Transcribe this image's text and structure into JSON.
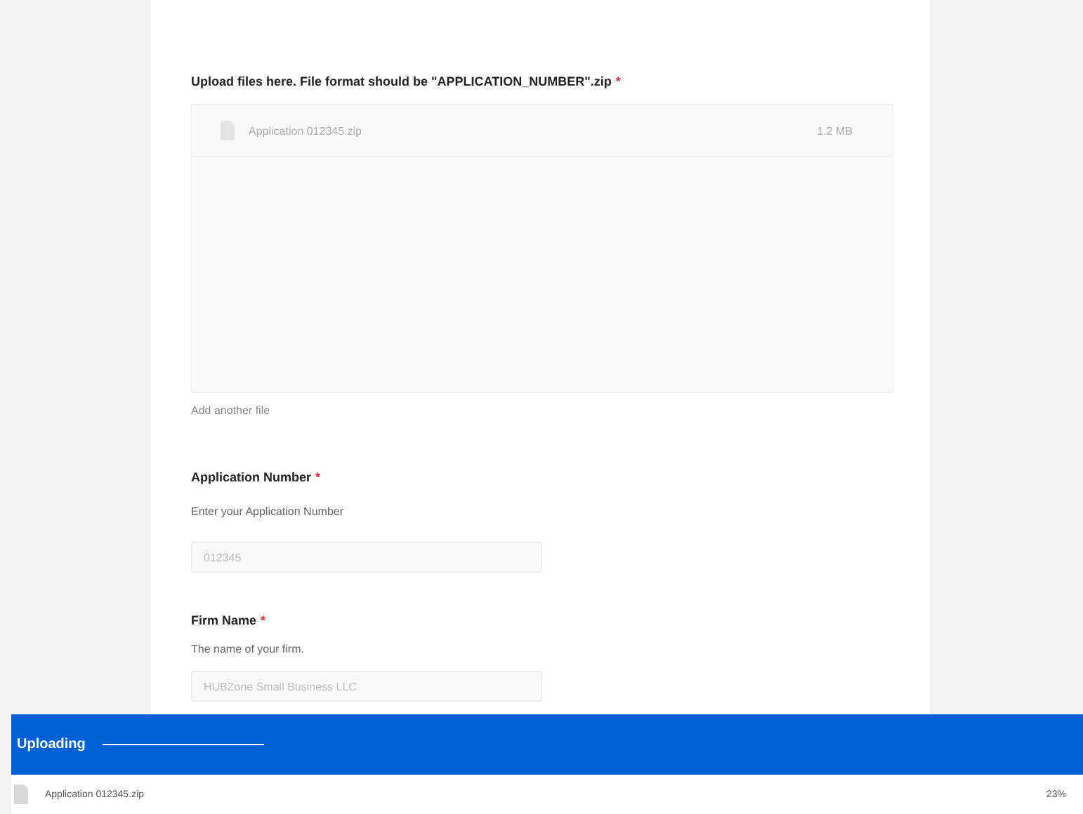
{
  "upload": {
    "label": "Upload files here. File format should be \"APPLICATION_NUMBER\".zip",
    "required_mark": "*",
    "files": [
      {
        "name": "Application 012345.zip",
        "size": "1.2 MB"
      }
    ],
    "add_link": "Add another file"
  },
  "fields": [
    {
      "label": "Application Number",
      "required_mark": "*",
      "description": "Enter your Application Number",
      "value": "012345"
    },
    {
      "label": "Firm Name",
      "required_mark": "*",
      "description": "The name of your firm.",
      "value": "HUBZone Small Business LLC"
    }
  ],
  "upload_panel": {
    "title": "Uploading",
    "items": [
      {
        "name": "Application 012345.zip",
        "percent": "23%"
      }
    ]
  }
}
